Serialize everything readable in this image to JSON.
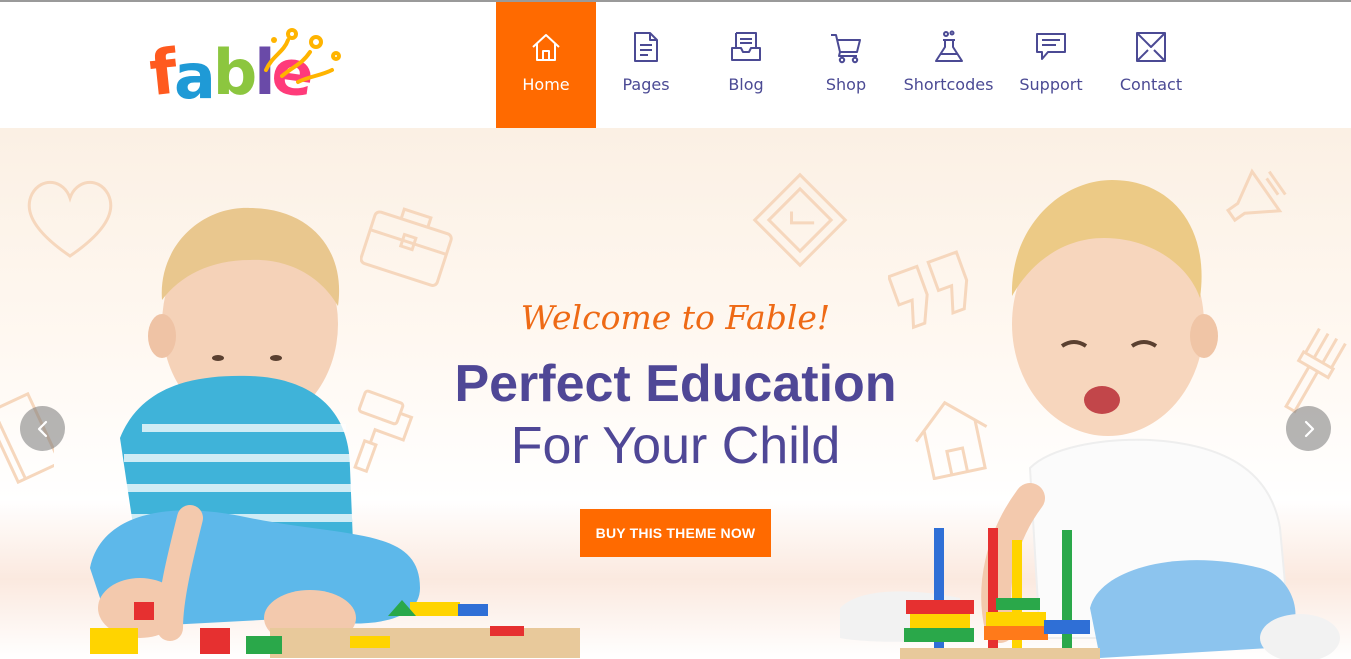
{
  "brand": {
    "name": "fable",
    "letters": [
      "f",
      "a",
      "b",
      "l",
      "e"
    ],
    "letter_colors": [
      "#ff5a1f",
      "#1f9ad6",
      "#8cc63f",
      "#6a4aa8",
      "#ff3b7a"
    ],
    "splash_color": "#ffb400"
  },
  "nav": {
    "items": [
      {
        "label": "Home",
        "icon": "home-icon",
        "active": true
      },
      {
        "label": "Pages",
        "icon": "document-icon",
        "active": false
      },
      {
        "label": "Blog",
        "icon": "inbox-icon",
        "active": false
      },
      {
        "label": "Shop",
        "icon": "cart-icon",
        "active": false
      },
      {
        "label": "Shortcodes",
        "icon": "flask-icon",
        "active": false
      },
      {
        "label": "Support",
        "icon": "chat-icon",
        "active": false
      },
      {
        "label": "Contact",
        "icon": "envelope-icon",
        "active": false
      }
    ]
  },
  "hero": {
    "welcome": "Welcome to Fable!",
    "headline": "Perfect Education",
    "subline": "For Your Child",
    "cta": "BUY THIS THEME NOW",
    "prev_icon": "chevron-left-icon",
    "next_icon": "chevron-right-icon"
  },
  "colors": {
    "accent": "#ff6a00",
    "nav_text": "#4b4a94",
    "headline": "#4f4796",
    "welcome": "#ee6a16",
    "doodle": "#f6d7bd"
  }
}
